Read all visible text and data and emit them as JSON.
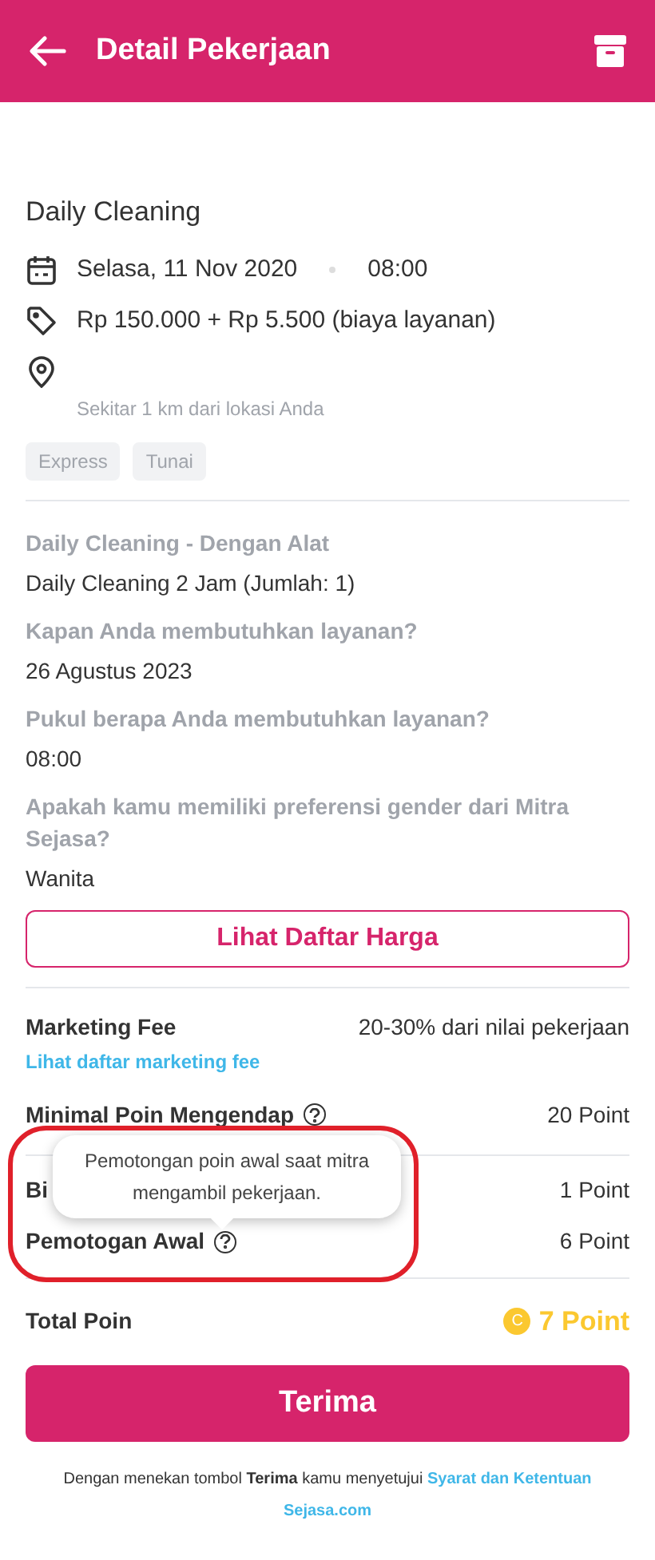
{
  "header": {
    "title": "Detail Pekerjaan"
  },
  "job": {
    "title": "Daily Cleaning",
    "date": "Selasa, 11 Nov 2020",
    "time": "08:00",
    "price": "Rp 150.000 + Rp 5.500 (biaya layanan)",
    "distance": "Sekitar 1 km dari lokasi Anda",
    "tags": [
      "Express",
      "Tunai"
    ]
  },
  "details": [
    {
      "question": "Daily Cleaning - Dengan Alat",
      "answer": "Daily Cleaning 2 Jam (Jumlah: 1)"
    },
    {
      "question": "Kapan Anda membutuhkan layanan?",
      "answer": "26 Agustus 2023"
    },
    {
      "question": "Pukul berapa Anda membutuhkan layanan?",
      "answer": "08:00"
    },
    {
      "question": "Apakah kamu memiliki preferensi gender dari Mitra Sejasa?",
      "answer": "Wanita"
    }
  ],
  "price_list_button": "Lihat Daftar Harga",
  "marketing_fee": {
    "label": "Marketing Fee",
    "value": "20-30% dari nilai pekerjaan",
    "link": "Lihat daftar marketing fee"
  },
  "minimum_points": {
    "label": "Minimal Poin Mengendap",
    "value": "20 Point"
  },
  "point_rows": [
    {
      "label": "Bi",
      "value": "1 Point"
    },
    {
      "label": "Pemotogan Awal",
      "value": "6 Point",
      "help": true
    }
  ],
  "tooltip": "Pemotongan poin awal saat mitra mengambil pekerjaan.",
  "total": {
    "label": "Total Poin",
    "coin": "C",
    "value": "7 Point"
  },
  "accept_button": "Terima",
  "footer": {
    "text": "Dengan menekan tombol **Terima** kamu menyetujui",
    "link_lines": [
      "Syarat dan Ketentuan",
      "Sejasa.com"
    ]
  }
}
